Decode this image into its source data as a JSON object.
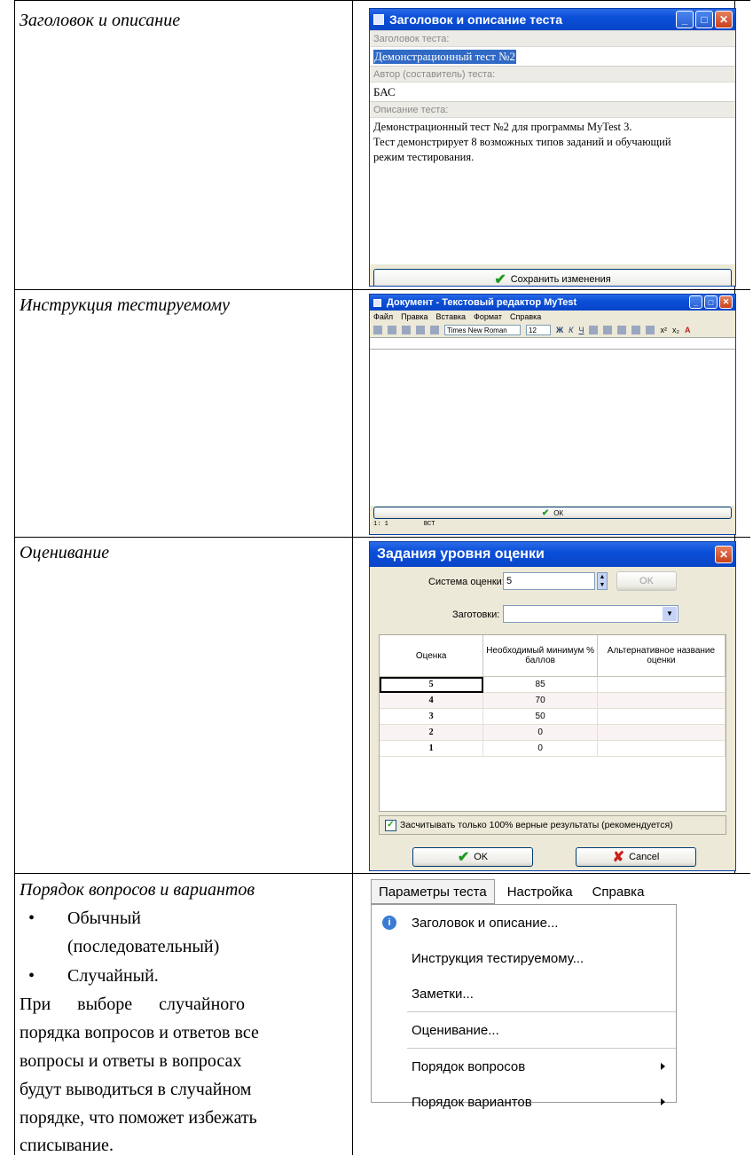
{
  "rows": {
    "r1": "Заголовок и описание",
    "r2": "Инструкция тестируемому",
    "r3": "Оценивание",
    "r4": "Порядок вопросов и вариантов"
  },
  "bullets": [
    "Обычный",
    "(последовательный)",
    "Случайный."
  ],
  "paragraph": [
    "При      выборе      случайного",
    "порядка вопросов и ответов все",
    "вопросы и ответы в вопросах",
    "будут выводиться в случайном",
    "порядке, что поможет избежать",
    "списывание."
  ],
  "win1": {
    "title": "Заголовок и описание теста",
    "title_label": "Заголовок теста:",
    "title_value": "Демонстрационный тест №2",
    "author_label": "Автор (составитель) теста:",
    "author_value": "БАС",
    "desc_label": "Описание теста:",
    "desc_lines": [
      "Демонстрационный тест №2 для программы MyTest 3.",
      "Тест демонстрирует 8 возможных типов заданий и обучающий",
      "режим тестирования."
    ],
    "save_label": "Сохранить изменения"
  },
  "win2": {
    "title": "Документ - Текстовый редактор MyTest",
    "menu": [
      "Файл",
      "Правка",
      "Вставка",
      "Формат",
      "Справка"
    ],
    "font": "Times New Roman",
    "size": "12",
    "ok_label": "ОК",
    "status_pos": "1:  1",
    "status_mode": "ВСТ"
  },
  "win3": {
    "title": "Задания уровня оценки",
    "system_label": "Система оценки:",
    "system_value": "5",
    "ok_small": "OK",
    "preset_label": "Заготовки:",
    "headers": [
      "Оценка",
      "Необходимый минимум % баллов",
      "Альтернативное название оценки"
    ],
    "grades": [
      {
        "grade": "5",
        "min": "85"
      },
      {
        "grade": "4",
        "min": "70"
      },
      {
        "grade": "3",
        "min": "50"
      },
      {
        "grade": "2",
        "min": "0"
      },
      {
        "grade": "1",
        "min": "0"
      }
    ],
    "checkbox_label": "Засчитывать только 100% верные результаты (рекомендуется)",
    "ok_label": "OK",
    "cancel_label": "Cancel"
  },
  "menu": {
    "bar": [
      "Параметры теста",
      "Настройка",
      "Справка"
    ],
    "items": [
      "Заголовок и описание...",
      "Инструкция тестируемому...",
      "Заметки...",
      "Оценивание...",
      "Порядок вопросов",
      "Порядок вариантов"
    ]
  },
  "colors": {
    "titlebar": "#0a4fd8",
    "selection": "#316ac5",
    "check_green": "#1c9a1c"
  }
}
